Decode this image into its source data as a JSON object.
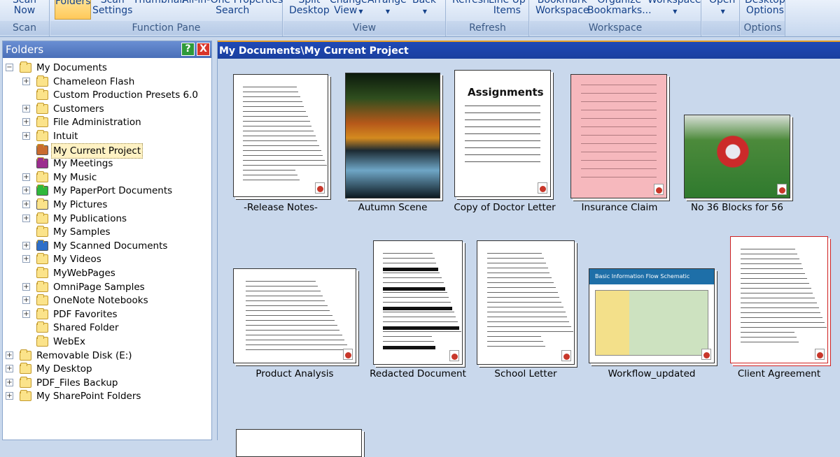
{
  "ribbon": {
    "groups": [
      {
        "title": "Scan"
      },
      {
        "title": "Function Pane"
      },
      {
        "title": "View"
      },
      {
        "title": "Refresh"
      },
      {
        "title": "Workspace"
      },
      {
        "title": ""
      },
      {
        "title": "Options"
      }
    ],
    "buttons": {
      "scan_now": "Scan\nNow",
      "folders": "Folders",
      "scan_settings": "Scan\nSettings",
      "thumbnail_search": "Thumbnail",
      "all_in_one_search": "All-in-One Properties\nSearch",
      "split_desktop": "Split\nDesktop",
      "change_view": "Change\nView",
      "arrange": "Arrange",
      "back": "Back",
      "refresh": "Refresh",
      "line_up_items": "Line Up\nItems",
      "bookmark_workspace": "Bookmark\nWorkspace",
      "organize_bookmarks": "Organize\nBookmarks...",
      "workspace": "Workspace",
      "open": "Open",
      "desktop_options": "Desktop\nOptions"
    }
  },
  "folders_pane": {
    "title": "Folders",
    "help_label": "?",
    "close_label": "X",
    "items": [
      {
        "label": "My Documents",
        "level": 0,
        "expander": "−"
      },
      {
        "label": "Chameleon Flash",
        "level": 1,
        "expander": "+"
      },
      {
        "label": "Custom Production Presets 6.0",
        "level": 1,
        "expander": ""
      },
      {
        "label": "Customers",
        "level": 1,
        "expander": "+"
      },
      {
        "label": "File Administration",
        "level": 1,
        "expander": "+"
      },
      {
        "label": "Intuit",
        "level": 1,
        "expander": "+"
      },
      {
        "label": "My Current Project",
        "level": 1,
        "expander": "",
        "selected": true
      },
      {
        "label": "My Meetings",
        "level": 1,
        "expander": ""
      },
      {
        "label": "My Music",
        "level": 1,
        "expander": "+"
      },
      {
        "label": "My PaperPort Documents",
        "level": 1,
        "expander": "+"
      },
      {
        "label": "My Pictures",
        "level": 1,
        "expander": "+"
      },
      {
        "label": "My Publications",
        "level": 1,
        "expander": "+"
      },
      {
        "label": "My Samples",
        "level": 1,
        "expander": ""
      },
      {
        "label": "My Scanned Documents",
        "level": 1,
        "expander": "+"
      },
      {
        "label": "My Videos",
        "level": 1,
        "expander": "+"
      },
      {
        "label": "MyWebPages",
        "level": 1,
        "expander": ""
      },
      {
        "label": "OmniPage Samples",
        "level": 1,
        "expander": "+"
      },
      {
        "label": "OneNote Notebooks",
        "level": 1,
        "expander": "+"
      },
      {
        "label": "PDF Favorites",
        "level": 1,
        "expander": "+"
      },
      {
        "label": "Shared Folder",
        "level": 1,
        "expander": ""
      },
      {
        "label": "WebEx",
        "level": 1,
        "expander": ""
      },
      {
        "label": "Removable Disk (E:)",
        "level": 0,
        "expander": "+"
      },
      {
        "label": "My Desktop",
        "level": 0,
        "expander": "+"
      },
      {
        "label": "PDF_Files Backup",
        "level": 0,
        "expander": "+"
      },
      {
        "label": "My SharePoint Folders",
        "level": 0,
        "expander": "+"
      }
    ]
  },
  "content": {
    "path": "My Documents\\My Current Project",
    "items": [
      {
        "caption": "-Release Notes-",
        "kind": "doc-word"
      },
      {
        "caption": "Autumn Scene",
        "kind": "photo-autumn"
      },
      {
        "caption": "Copy of Doctor Letter",
        "kind": "doc-assignments",
        "heading": "Assignments"
      },
      {
        "caption": "Insurance Claim",
        "kind": "doc-pink"
      },
      {
        "caption": "No 36 Blocks for 56",
        "kind": "photo-football"
      },
      {
        "caption": "Product Analysis",
        "kind": "doc-excel"
      },
      {
        "caption": "Redacted Document",
        "kind": "doc-redacted"
      },
      {
        "caption": "School Letter",
        "kind": "doc-letter"
      },
      {
        "caption": "Workflow_updated",
        "kind": "doc-workflow",
        "heading": "Basic Information Flow Schematic"
      },
      {
        "caption": "Client Agreement",
        "kind": "doc-agreement"
      },
      {
        "caption": "",
        "kind": "doc-signature"
      }
    ]
  }
}
